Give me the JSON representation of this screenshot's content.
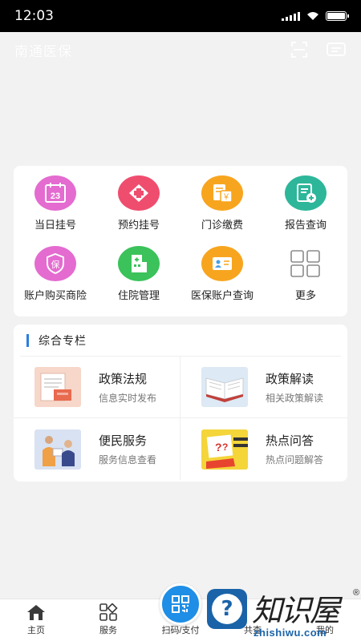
{
  "status_bar": {
    "time": "12:03"
  },
  "app_bar": {
    "title": "南通医保"
  },
  "services": [
    {
      "label": "当日挂号",
      "icon": "calendar-23-icon",
      "color": "#e46bd0",
      "badge": "23"
    },
    {
      "label": "预约挂号",
      "icon": "medical-cross-icon",
      "color": "#ef4d6e"
    },
    {
      "label": "门诊缴费",
      "icon": "bill-yen-icon",
      "color": "#f7a51f",
      "badge": "￥"
    },
    {
      "label": "报告查询",
      "icon": "report-add-icon",
      "color": "#2db69a"
    },
    {
      "label": "账户购买商险",
      "icon": "insurance-shield-icon",
      "color": "#e46bd0",
      "badge": "保"
    },
    {
      "label": "住院管理",
      "icon": "hospital-building-icon",
      "color": "#3bc25a"
    },
    {
      "label": "医保账户查询",
      "icon": "id-card-icon",
      "color": "#f7a51f"
    },
    {
      "label": "更多",
      "icon": "grid-more-icon",
      "color": "#888888"
    }
  ],
  "section": {
    "title": "综合专栏",
    "accent": "#2a7fe0",
    "items": [
      {
        "title": "政策法规",
        "subtitle": "信息实时发布",
        "icon": "policy-document-icon"
      },
      {
        "title": "政策解读",
        "subtitle": "相关政策解读",
        "icon": "open-book-icon"
      },
      {
        "title": "便民服务",
        "subtitle": "服务信息查看",
        "icon": "service-people-icon"
      },
      {
        "title": "热点问答",
        "subtitle": "热点问题解答",
        "icon": "question-answer-icon"
      }
    ]
  },
  "tab_bar": {
    "home": "主页",
    "service": "服务",
    "scan": "扫码/支付",
    "partial_a": "共查",
    "partial_b": "我的"
  },
  "watermark": {
    "badge": "?",
    "text": "知识屋",
    "reg": "®",
    "url": "zhishiwu.com"
  }
}
